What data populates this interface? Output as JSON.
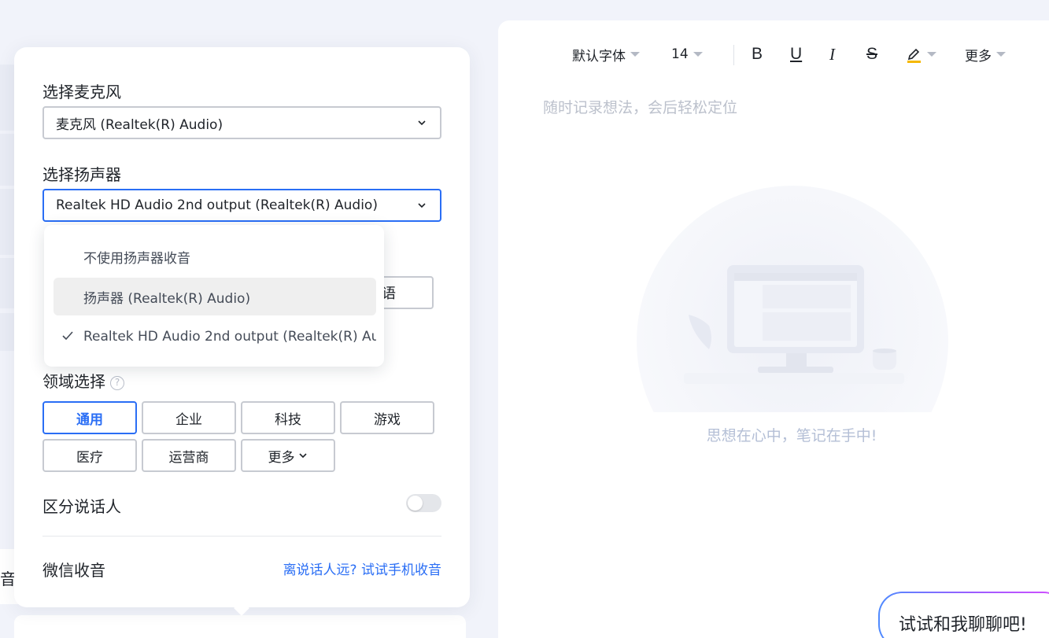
{
  "popover": {
    "mic_label": "选择麦克风",
    "mic_value": "麦克风 (Realtek(R) Audio)",
    "speaker_label": "选择扬声器",
    "speaker_value": "Realtek HD Audio 2nd output (Realtek(R) Audio)",
    "speaker_options": [
      {
        "label": "不使用扬声器收音",
        "selected": false
      },
      {
        "label": "扬声器 (Realtek(R) Audio)",
        "selected": false
      },
      {
        "label": "Realtek HD Audio 2nd output (Realtek(R) Au...",
        "selected": true
      }
    ],
    "hidden_button_partial": "语",
    "domain_label": "领域选择",
    "domain_help": "?",
    "domains": [
      "通用",
      "企业",
      "科技",
      "游戏",
      "医疗",
      "运营商",
      "更多"
    ],
    "domain_selected": "通用",
    "speaker_diarization_label": "区分说话人",
    "speaker_diarization_on": false,
    "wechat_label": "微信收音",
    "wechat_link": "离说话人远? 试试手机收音"
  },
  "editor": {
    "font": "默认字体",
    "size": "14",
    "bold": "B",
    "underline": "U",
    "italic": "I",
    "strike": "S",
    "more": "更多",
    "placeholder": "随时记录想法，会后轻松定位",
    "empty_caption": "思想在心中，笔记在手中!"
  },
  "background": {
    "left_partial_text": "音"
  },
  "chat": {
    "label": "试试和我聊聊吧!"
  },
  "colors": {
    "accent": "#2a6ef5",
    "page_bg": "#f1f3fa",
    "highlight_underline": "#f5b800"
  }
}
